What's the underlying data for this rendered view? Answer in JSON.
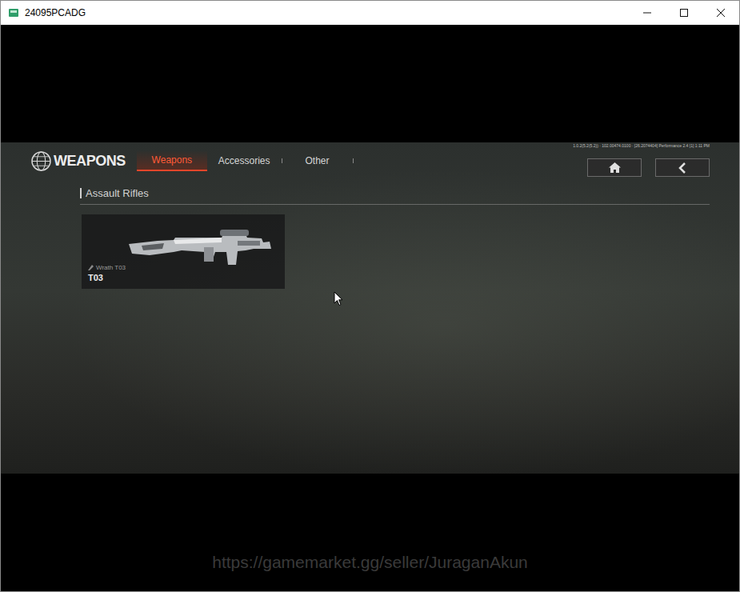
{
  "window": {
    "title": "24095PCADG"
  },
  "header": {
    "title": "WEAPONS",
    "version": "1.0.2(5.2(5.2)) · 102.00474.0100 · [26.2074404] Performance 2.4 [1] 1:11 PM"
  },
  "tabs": [
    {
      "label": "Weapons",
      "selected": true
    },
    {
      "label": "Accessories",
      "selected": false
    },
    {
      "label": "Other",
      "selected": false
    }
  ],
  "section": {
    "title": "Assault Rifles"
  },
  "items": [
    {
      "skin": "Wrath T03",
      "name": "T03"
    }
  ],
  "watermark": "https://gamemarket.gg/seller/JuraganAkun"
}
